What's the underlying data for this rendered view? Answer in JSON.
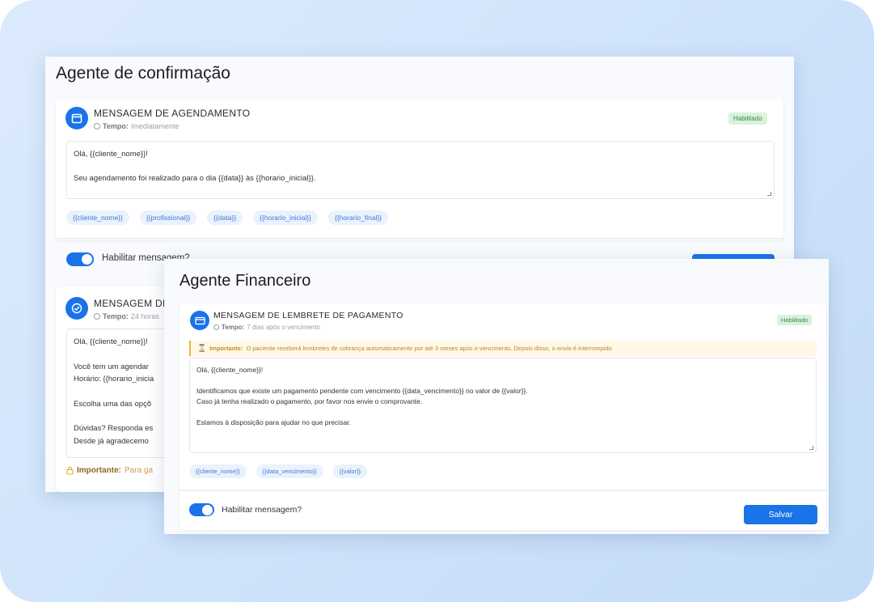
{
  "agent1": {
    "title": "Agente de confirmação",
    "card1": {
      "heading": "MENSAGEM DE AGENDAMENTO",
      "time_label": "Tempo:",
      "time_value": "Imediatamente",
      "badge": "Habilitado",
      "message_lines": [
        "Olá, {{cliente_nome}}!",
        "",
        "Seu agendamento foi realizado para o dia {{data}} às {{horario_inicial}}."
      ],
      "chips": [
        "{{cliente_nome}}",
        "{{profissional}}",
        "{{data}}",
        "{{horario_inicial}}",
        "{{horario_final}}"
      ],
      "toggle_label": "Habilitar mensagem?"
    },
    "card2": {
      "heading": "MENSAGEM DE",
      "time_label": "Tempo:",
      "time_value": "24 horas",
      "message_lines": [
        "Olá, {{cliente_nome}}!",
        "",
        "Você tem um agendar",
        "Horário: {{horario_inicia",
        "",
        "Escolha uma das opçõ",
        "",
        "Dúvidas? Responda es",
        "Desde já agradecemo"
      ],
      "important_label": "Importante:",
      "important_text": "Para ga"
    }
  },
  "agent2": {
    "title": "Agente Financeiro",
    "card": {
      "heading": "MENSAGEM DE LEMBRETE DE PAGAMENTO",
      "time_label": "Tempo:",
      "time_value": "7 dias após o vencimento",
      "badge": "Habilitado",
      "warning_label": "Importante:",
      "warning_text": "O paciente receberá lembretes de cobrança automaticamente por até 3 meses após o vencimento. Depois disso, o envio é interrompido",
      "message_lines": [
        "Olá, {{cliente_nome}}!",
        "",
        "Identificamos que existe um pagamento pendente com vencimento {{data_vencimento}} no valor de {{valor}}.",
        "Caso já tenha realizado o pagamento, por favor nos envie o comprovante.",
        "",
        "Estamos à disposição para ajudar no que precisar."
      ],
      "chips": [
        "{{cliente_nome}}",
        "{{data_vencimento}}",
        "{{valor}}"
      ],
      "toggle_label": "Habilitar mensagem?",
      "save_label": "Salvar"
    }
  },
  "colors": {
    "accent": "#1a73e8",
    "badge_bg": "#d9f2dc",
    "warning": "#f0b43c"
  },
  "icons": [
    "calendar-icon",
    "check-circle-icon",
    "payment-icon",
    "clock-icon",
    "warning-icon",
    "lock-icon"
  ]
}
